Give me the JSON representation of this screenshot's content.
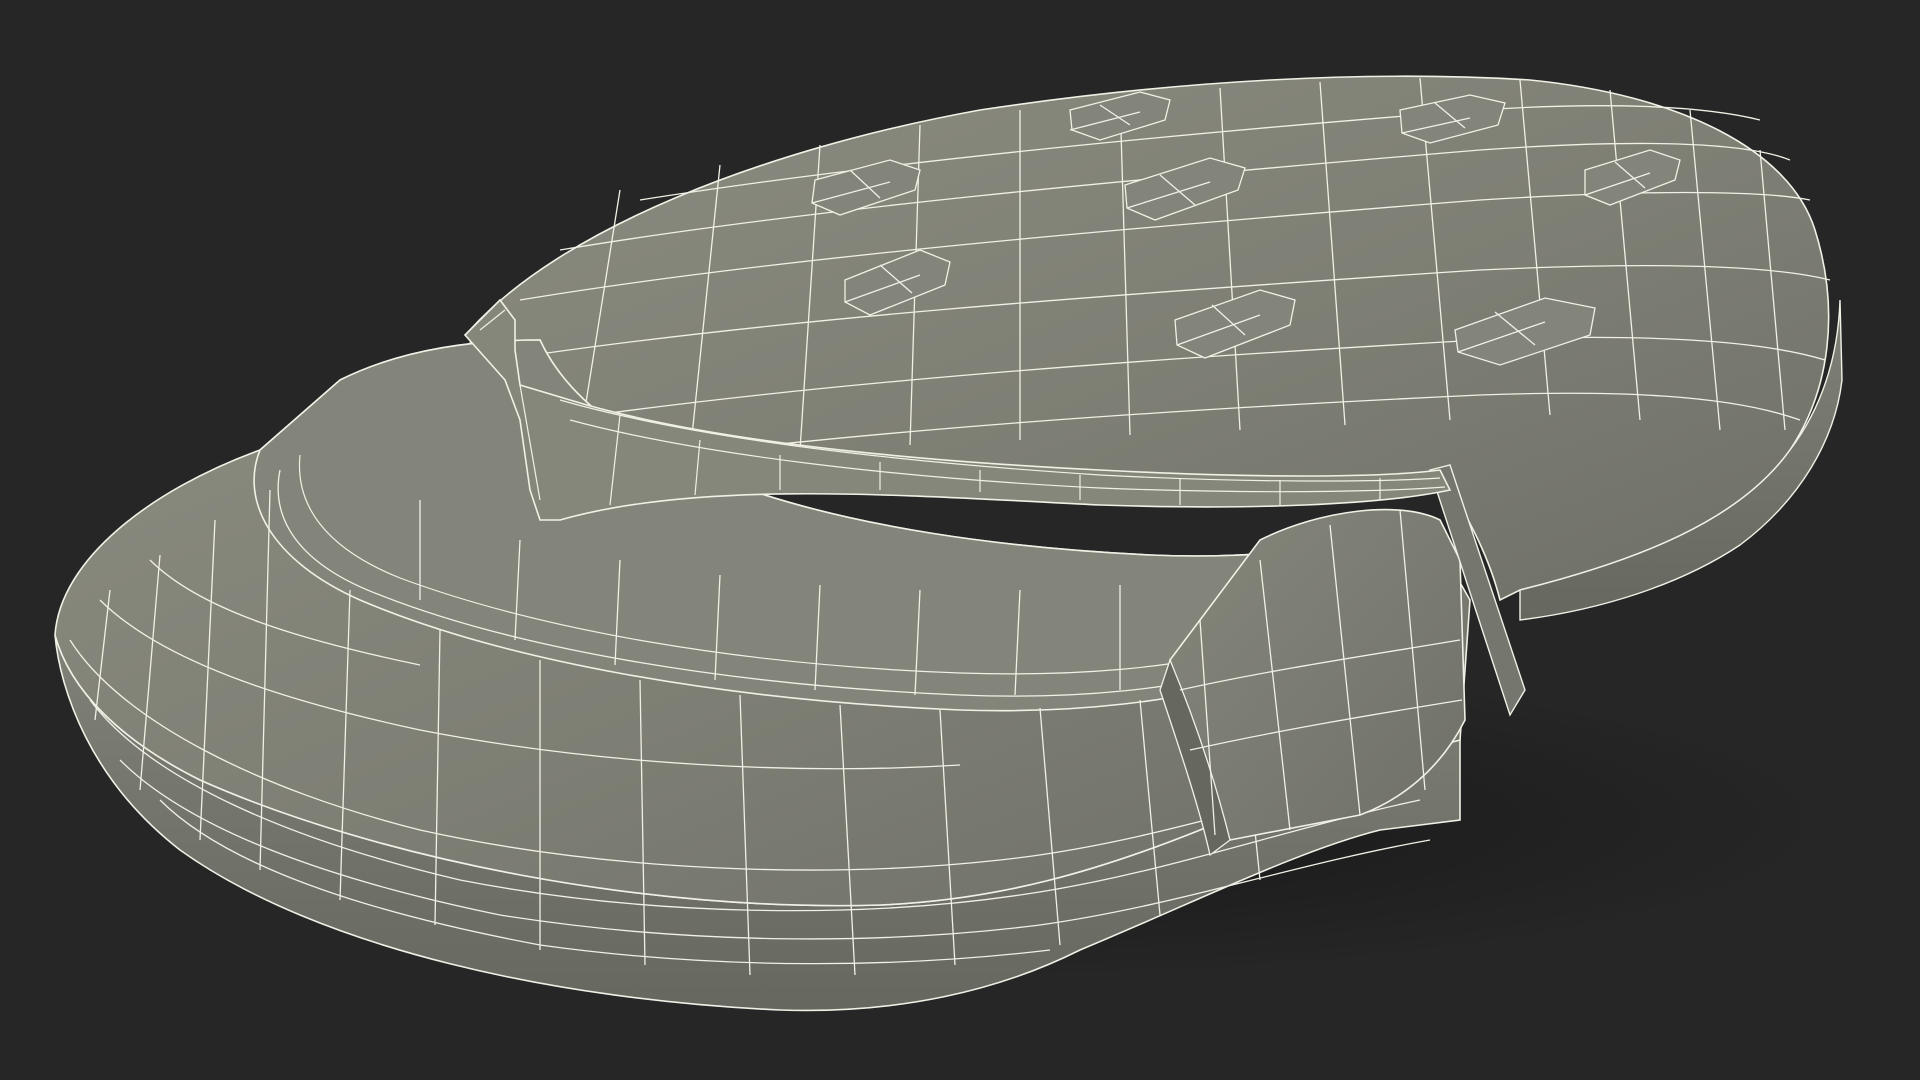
{
  "scene": {
    "subject": "wireframe-3d-sole-model",
    "background_color": "#262626",
    "mesh_fill_light": "#8a8b7f",
    "mesh_fill_mid": "#7c7d72",
    "mesh_fill_dark": "#5f6058",
    "wire_color": "#f1f0e6",
    "shadow_color": "#1b1b1b"
  }
}
